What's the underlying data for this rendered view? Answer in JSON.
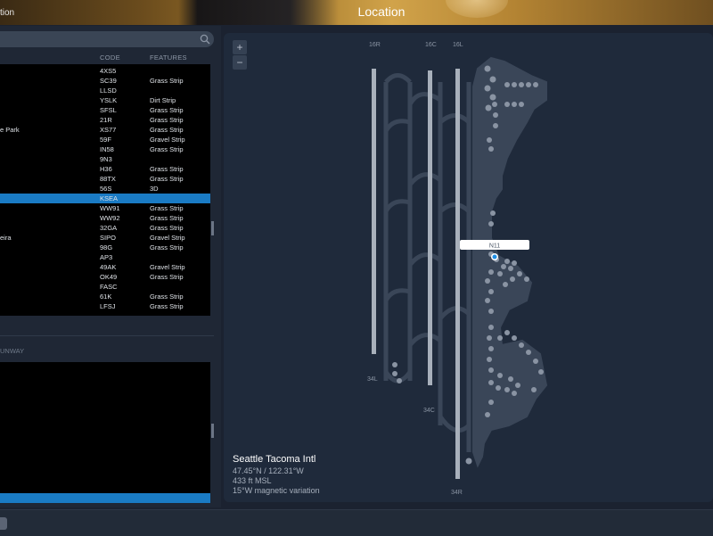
{
  "header": {
    "title": "Location",
    "left_fragment": "tion"
  },
  "search": {
    "placeholder": ""
  },
  "airport_list": {
    "columns": [
      "CODE",
      "FEATURES"
    ],
    "rows": [
      {
        "name": "",
        "code": "4XS5",
        "features": ""
      },
      {
        "name": "",
        "code": "SC39",
        "features": "Grass Strip"
      },
      {
        "name": "",
        "code": "LLSD",
        "features": ""
      },
      {
        "name": "",
        "code": "YSLK",
        "features": "Dirt Strip"
      },
      {
        "name": "",
        "code": "SFSL",
        "features": "Grass Strip"
      },
      {
        "name": "",
        "code": "21R",
        "features": "Grass Strip"
      },
      {
        "name": "e Park",
        "code": "XS77",
        "features": "Grass Strip"
      },
      {
        "name": "",
        "code": "59F",
        "features": "Gravel Strip"
      },
      {
        "name": "",
        "code": "IN58",
        "features": "Grass Strip"
      },
      {
        "name": "",
        "code": "9N3",
        "features": ""
      },
      {
        "name": "",
        "code": "H36",
        "features": "Grass Strip"
      },
      {
        "name": "",
        "code": "88TX",
        "features": "Grass Strip"
      },
      {
        "name": "",
        "code": "56S",
        "features": "3D"
      },
      {
        "name": "",
        "code": "KSEA",
        "features": "",
        "selected": true
      },
      {
        "name": "",
        "code": "WW91",
        "features": "Grass Strip"
      },
      {
        "name": "",
        "code": "WW92",
        "features": "Grass Strip"
      },
      {
        "name": "",
        "code": "32GA",
        "features": "Grass Strip"
      },
      {
        "name": "eira",
        "code": "SIPO",
        "features": "Gravel Strip"
      },
      {
        "name": "",
        "code": "98G",
        "features": "Grass Strip"
      },
      {
        "name": "",
        "code": "AP3",
        "features": ""
      },
      {
        "name": "",
        "code": "49AK",
        "features": "Gravel Strip"
      },
      {
        "name": "",
        "code": "OK49",
        "features": "Grass Strip"
      },
      {
        "name": "",
        "code": "FASC",
        "features": ""
      },
      {
        "name": "",
        "code": "61K",
        "features": "Grass Strip"
      },
      {
        "name": "",
        "code": "LFSJ",
        "features": "Grass Strip"
      }
    ]
  },
  "runway_section": {
    "label": "UNWAY"
  },
  "map": {
    "zoom_in": "+",
    "zoom_out": "−",
    "runway_labels": {
      "top_left": "16R",
      "top_center": "16C",
      "top_right": "16L",
      "bottom_left": "34L",
      "bottom_center": "34C",
      "bottom_right": "34R"
    },
    "gate_label": "N11",
    "marker_color": "#1f8fe6"
  },
  "airport_info": {
    "name": "Seattle Tacoma Intl",
    "coords": "47.45°N / 122.31°W",
    "elevation": "433 ft MSL",
    "variation": "15°W magnetic variation"
  }
}
